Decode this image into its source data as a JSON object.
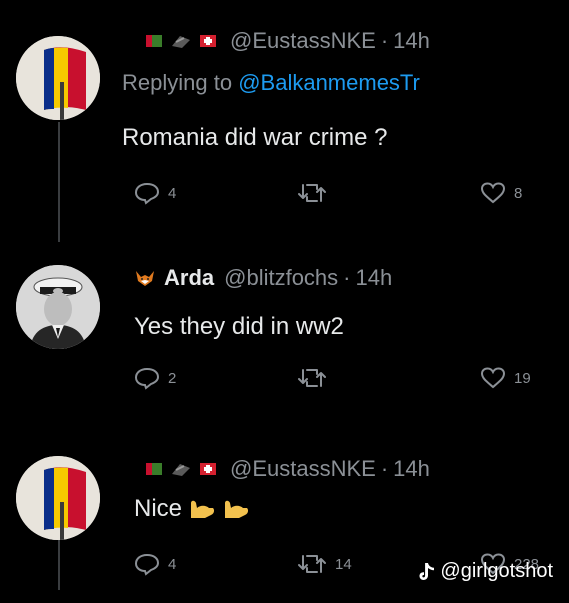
{
  "tweets": [
    {
      "author": {
        "display_name": "",
        "handle": "@EustassNKE",
        "time": "14h",
        "flags": [
          "flag-icon",
          "flag-icon",
          "flag-icon"
        ]
      },
      "reply_prefix": "Replying to",
      "reply_to": "@BalkanmemesTr",
      "text": "Romania did war crime ?",
      "counts": {
        "replies": "4",
        "retweets": "",
        "likes": "8"
      }
    },
    {
      "author": {
        "display_name": "Arda",
        "handle": "@blitzfochs",
        "time": "14h"
      },
      "text": "Yes they did in ww2",
      "counts": {
        "replies": "2",
        "retweets": "",
        "likes": "19"
      }
    },
    {
      "author": {
        "display_name": "",
        "handle": "@EustassNKE",
        "time": "14h",
        "flags": [
          "flag-icon",
          "flag-icon",
          "flag-icon"
        ]
      },
      "text": "Nice",
      "text_emoji": [
        "flexed-biceps-icon",
        "flexed-biceps-icon"
      ],
      "counts": {
        "replies": "4",
        "retweets": "14",
        "likes": "228"
      }
    }
  ],
  "separator": "·",
  "watermark": "@girlgotshot",
  "colors": {
    "background": "#000000",
    "text": "#e7e9ea",
    "muted": "#8b9096",
    "link": "#1d9bf0",
    "romania_blue": "#0a2e8a",
    "romania_yellow": "#f6c900",
    "romania_red": "#c8102e"
  }
}
